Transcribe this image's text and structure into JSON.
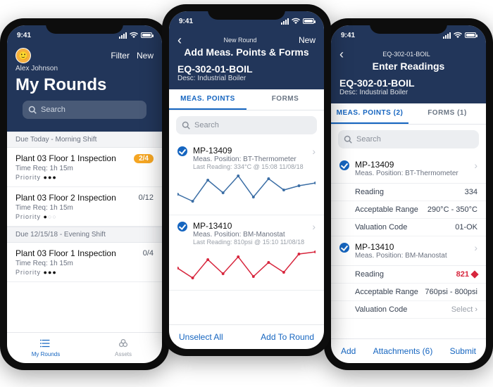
{
  "status": {
    "time": "9:41",
    "wifi": "wifi-icon",
    "signal": "signal-icon",
    "battery": "battery-icon"
  },
  "left": {
    "user": "Alex Johnson",
    "filter": "Filter",
    "new": "New",
    "title": "My Rounds",
    "search_placeholder": "Search",
    "sections": [
      {
        "label": "Due Today - Morning Shift",
        "items": [
          {
            "title": "Plant 03 Floor 1 Inspection",
            "time": "Time Req: 1h 15m",
            "priority": "●●●",
            "badge": "2/4"
          },
          {
            "title": "Plant 03 Floor 2 Inspection",
            "time": "Time Req: 1h 15m",
            "priority": "●○○",
            "count": "0/12"
          }
        ]
      },
      {
        "label": "Due 12/15/18 - Evening Shift",
        "items": [
          {
            "title": "Plant 03 Floor 1 Inspection",
            "time": "Time Req: 1h 15m",
            "priority": "●●●",
            "count": "0/4"
          }
        ]
      }
    ],
    "tabbar": {
      "rounds": "My Rounds",
      "assets": "Assets"
    }
  },
  "mid": {
    "breadcrumb": "New Round",
    "title": "Add Meas. Points & Forms",
    "new": "New",
    "equip": "EQ-302-01-BOIL",
    "desc": "Desc: Industrial Boiler",
    "tabs": {
      "points": "MEAS. POINTS",
      "forms": "FORMS"
    },
    "search_placeholder": "Search",
    "mp": [
      {
        "id": "MP-13409",
        "pos": "Meas. Position: BT-Thermometer",
        "last": "Last Reading: 334°C @ 15:08 11/08/18",
        "color": "#3b6ea5"
      },
      {
        "id": "MP-13410",
        "pos": "Meas. Position: BM-Manostat",
        "last": "Last Reading: 810psi @ 15:10 11/08/18",
        "color": "#d7263d"
      }
    ],
    "footer": {
      "left": "Unselect All",
      "right": "Add To Round"
    }
  },
  "right": {
    "breadcrumb": "EQ-302-01-BOIL",
    "title": "Enter Readings",
    "equip": "EQ-302-01-BOIL",
    "desc": "Desc: Industrial Boiler",
    "tabs": {
      "points": "MEAS. POINTS (2)",
      "forms": "FORMS (1)"
    },
    "search_placeholder": "Search",
    "mp": [
      {
        "id": "MP-13409",
        "pos": "Meas. Position: BT-Thermometer",
        "reading_label": "Reading",
        "reading": "334",
        "range_label": "Acceptable Range",
        "range": "290°C - 350°C",
        "vc_label": "Valuation Code",
        "vc": "01-OK"
      },
      {
        "id": "MP-13410",
        "pos": "Meas. Position: BM-Manostat",
        "reading_label": "Reading",
        "reading": "821",
        "reading_alert": true,
        "range_label": "Acceptable Range",
        "range": "760psi - 800psi",
        "vc_label": "Valuation Code",
        "vc": "Select"
      }
    ],
    "footer": {
      "left": "Add",
      "mid": "Attachments (6)",
      "right": "Submit"
    }
  },
  "chart_data": [
    {
      "type": "line",
      "series_name": "MP-13409",
      "unit": "°C",
      "values": [
        300,
        290,
        340,
        310,
        350,
        305,
        345,
        320,
        330,
        334
      ],
      "ylim": [
        280,
        360
      ],
      "color": "#3b6ea5"
    },
    {
      "type": "line",
      "series_name": "MP-13410",
      "unit": "psi",
      "values": [
        780,
        760,
        795,
        770,
        800,
        765,
        790,
        775,
        805,
        810
      ],
      "ylim": [
        750,
        820
      ],
      "color": "#d7263d"
    }
  ]
}
